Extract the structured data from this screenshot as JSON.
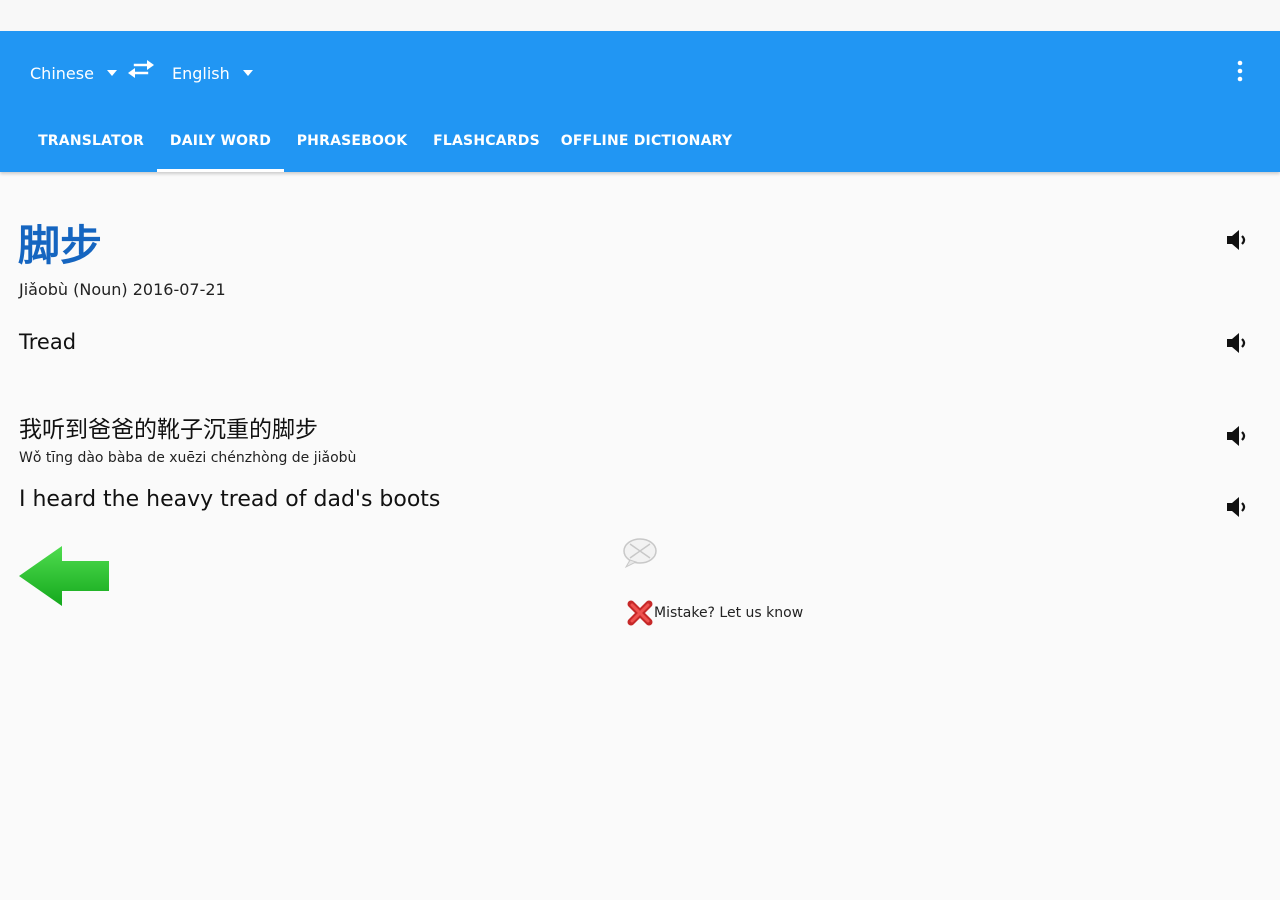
{
  "header": {
    "source_language": "Chinese",
    "target_language": "English",
    "swap_icon": "swap-arrows-icon",
    "menu_icon": "overflow-menu-icon"
  },
  "tabs": [
    {
      "label": "TRANSLATOR",
      "active": false
    },
    {
      "label": "DAILY WORD",
      "active": true
    },
    {
      "label": "PHRASEBOOK",
      "active": false
    },
    {
      "label": "FLASHCARDS",
      "active": false
    },
    {
      "label": "OFFLINE DICTIONARY",
      "active": false
    }
  ],
  "daily_word": {
    "word": "脚步",
    "meta": "Jiǎobù (Noun) 2016-07-21",
    "translation": "Tread",
    "example_chinese": "我听到爸爸的靴子沉重的脚步",
    "example_pinyin": "Wǒ tīng dào bàba de xuēzi chénzhòng de jiǎobù",
    "example_english": "I heard the heavy tread of dad's boots"
  },
  "feedback": {
    "mistake_label": "Mistake? Let us know"
  },
  "colors": {
    "appbar": "#2196f3",
    "word": "#1565c0",
    "arrow": "#22c32a",
    "mistake_x": "#d32f2f"
  }
}
